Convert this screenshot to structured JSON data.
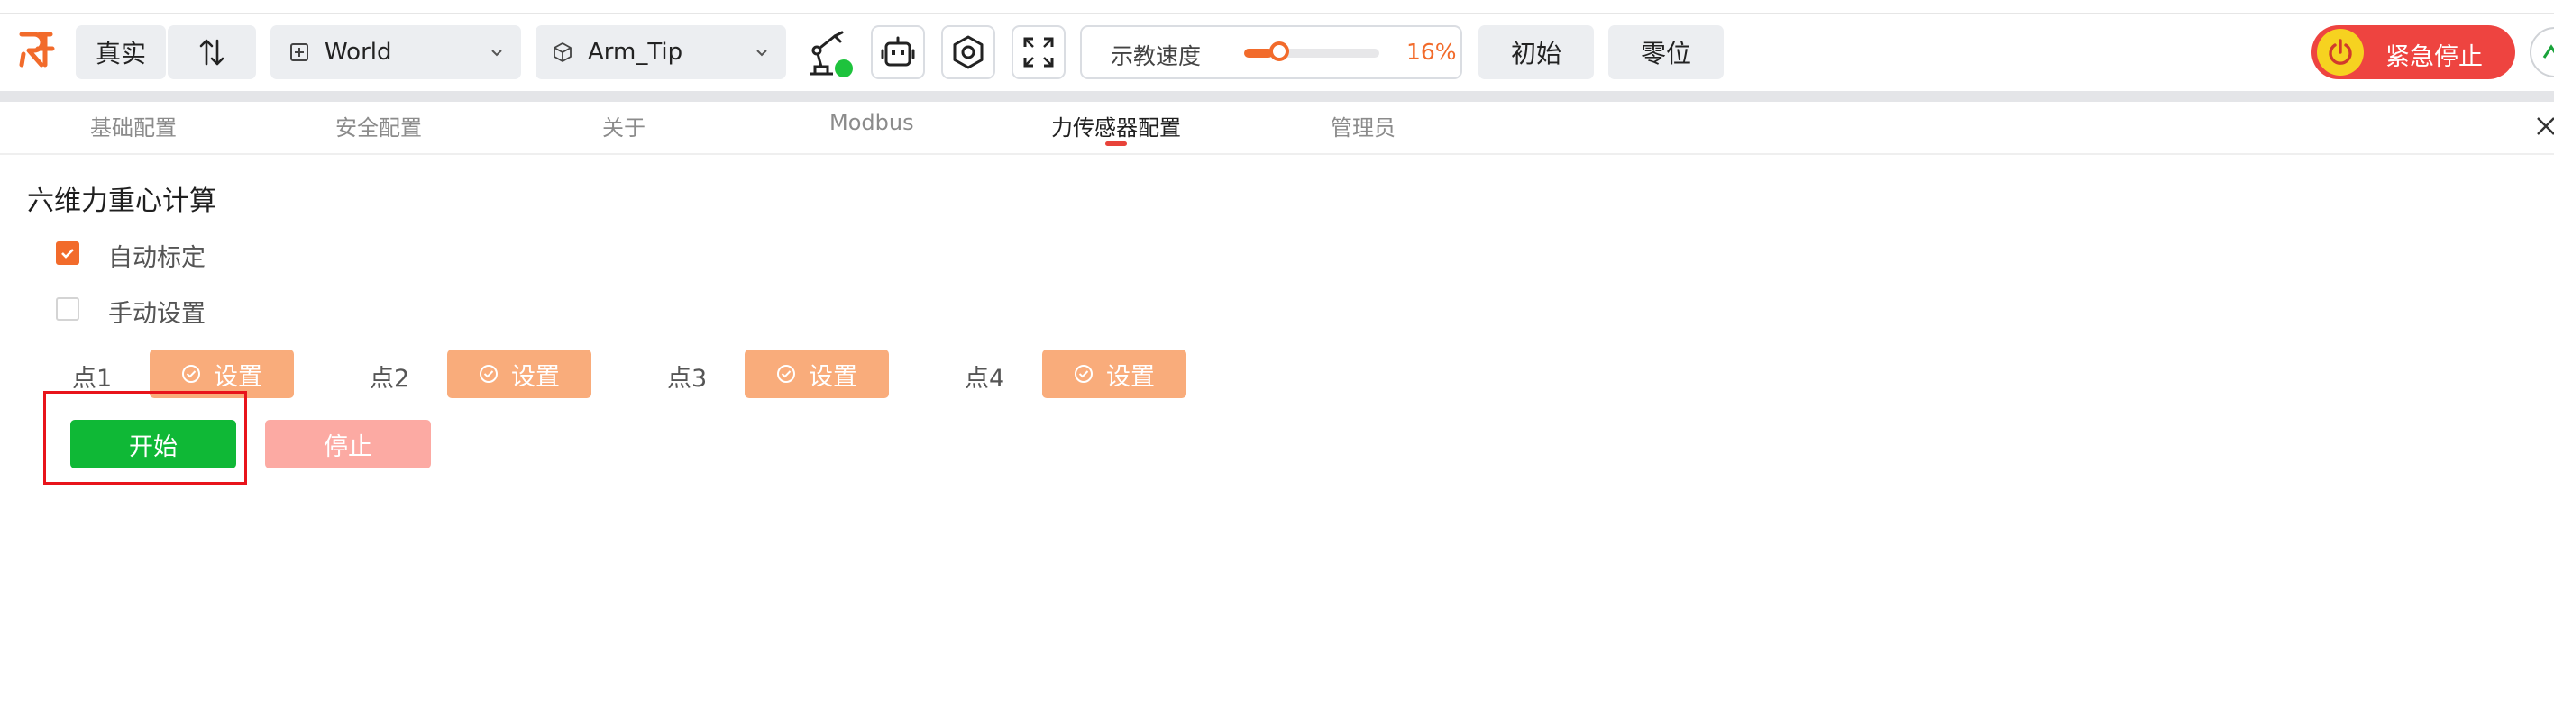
{
  "toolbar": {
    "mode_label": "真实",
    "coord_frame": "World",
    "tool_frame": "Arm_Tip",
    "speed_label": "示教速度",
    "speed_value": "16%",
    "speed_fraction": 0.16,
    "init_label": "初始",
    "zero_label": "零位",
    "estop_label": "紧急停止"
  },
  "tabs": [
    {
      "label": "基础配置"
    },
    {
      "label": "安全配置"
    },
    {
      "label": "关于"
    },
    {
      "label": "Modbus"
    },
    {
      "label": "力传感器配置"
    },
    {
      "label": "管理员"
    }
  ],
  "active_tab": "力传感器配置",
  "section": {
    "title": "六维力重心计算",
    "auto_label": "自动标定",
    "auto_checked": true,
    "manual_label": "手动设置",
    "manual_checked": false
  },
  "points": [
    {
      "label": "点1",
      "button": "设置"
    },
    {
      "label": "点2",
      "button": "设置"
    },
    {
      "label": "点3",
      "button": "设置"
    },
    {
      "label": "点4",
      "button": "设置"
    }
  ],
  "actions": {
    "start_label": "开始",
    "stop_label": "停止"
  },
  "colors": {
    "accent": "#f26b2b",
    "start": "#0fb836",
    "stop_disabled": "#fcaaa3",
    "set_button": "#f9ac7b",
    "estop": "#ee4440",
    "highlight_box": "#e8141b"
  }
}
